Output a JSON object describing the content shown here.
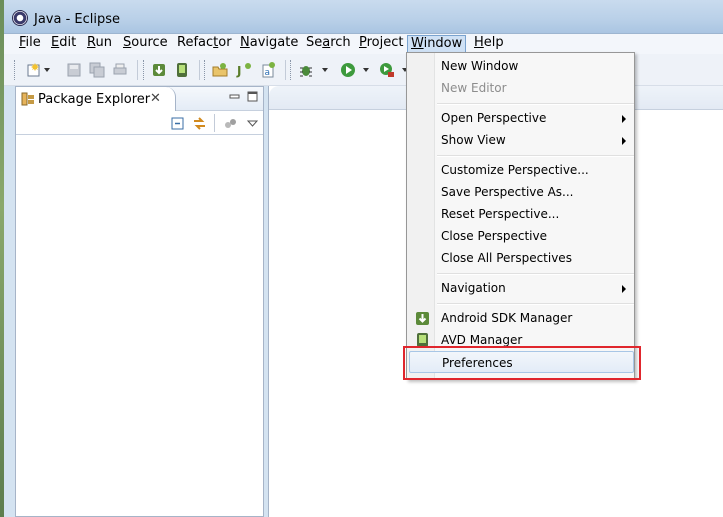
{
  "window": {
    "title": "Java - Eclipse"
  },
  "menubar": {
    "items": [
      {
        "label_ul": "F",
        "label_rest": "ile"
      },
      {
        "label_ul": "E",
        "label_rest": "dit"
      },
      {
        "label_ul": "R",
        "label_rest": "un"
      },
      {
        "label_ul": "S",
        "label_rest": "ource"
      },
      {
        "label_pre": "Refac",
        "label_ul": "t",
        "label_rest": "or"
      },
      {
        "label_ul": "N",
        "label_rest": "avigate"
      },
      {
        "label_pre": "Se",
        "label_ul": "a",
        "label_rest": "rch"
      },
      {
        "label_ul": "P",
        "label_rest": "roject"
      },
      {
        "label_ul": "W",
        "label_rest": "indow"
      },
      {
        "label_ul": "H",
        "label_rest": "elp"
      }
    ]
  },
  "package_explorer": {
    "tab_label": "Package Explorer",
    "close_glyph": "✕"
  },
  "window_menu": {
    "items": [
      {
        "label": "New Window"
      },
      {
        "label": "New Editor",
        "disabled": true
      },
      {
        "label": "Open Perspective",
        "submenu": true
      },
      {
        "label": "Show View",
        "submenu": true
      },
      {
        "label": "Customize Perspective..."
      },
      {
        "label": "Save Perspective As..."
      },
      {
        "label": "Reset Perspective..."
      },
      {
        "label": "Close Perspective"
      },
      {
        "label": "Close All Perspectives"
      },
      {
        "label": "Navigation",
        "submenu": true
      },
      {
        "label": "Android SDK Manager",
        "icon": "android-sdk-icon"
      },
      {
        "label": "AVD Manager",
        "icon": "avd-manager-icon"
      },
      {
        "label": "Preferences",
        "highlighted": true
      }
    ]
  },
  "colors": {
    "highlight_box": "#e0262d",
    "menu_hover": "#e3ecf7"
  }
}
